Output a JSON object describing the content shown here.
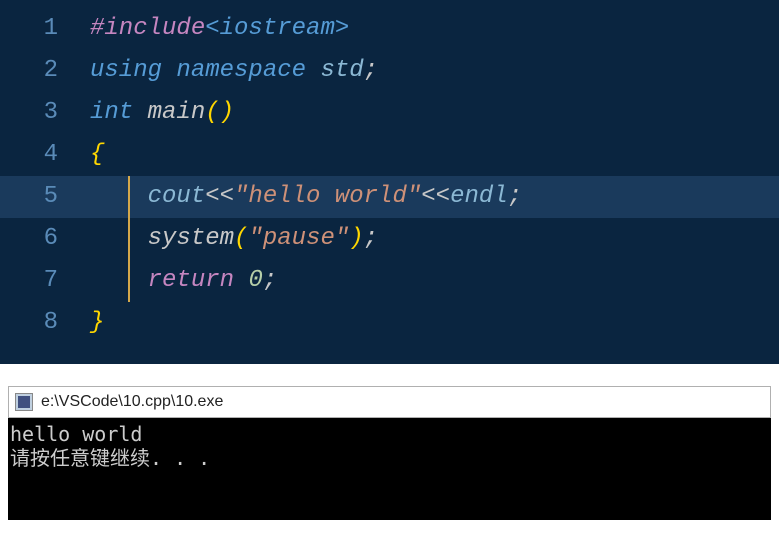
{
  "editor": {
    "lines": [
      {
        "num": "1"
      },
      {
        "num": "2"
      },
      {
        "num": "3"
      },
      {
        "num": "4"
      },
      {
        "num": "5"
      },
      {
        "num": "6"
      },
      {
        "num": "7"
      },
      {
        "num": "8"
      }
    ],
    "t": {
      "include": "#include",
      "iostream_open": "<",
      "iostream": "iostream",
      "iostream_close": ">",
      "using": "using",
      "namespace": "namespace",
      "std": "std",
      "int": "int",
      "main": "main",
      "lparen": "(",
      "rparen": ")",
      "lbrace": "{",
      "rbrace": "}",
      "cout": "cout",
      "ltlt": "<<",
      "hello_str": "\"hello world\"",
      "endl": "endl",
      "system": "system",
      "pause_str": "\"pause\"",
      "return": "return",
      "zero": "0",
      "semi": ";",
      "space": " "
    }
  },
  "console": {
    "title": "e:\\VSCode\\10.cpp\\10.exe",
    "line1": "hello world",
    "line2": "请按任意键继续. . ."
  }
}
